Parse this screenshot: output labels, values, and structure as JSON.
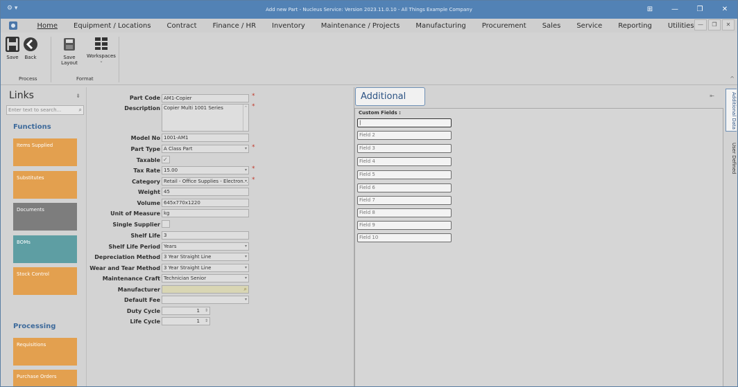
{
  "window": {
    "title": "Add new Part - Nucleus Service: Version 2023.11.0.10 - All Things Example Company",
    "controls": [
      "⊞",
      "—",
      "❐",
      "✕"
    ]
  },
  "menu": {
    "items": [
      "Home",
      "Equipment / Locations",
      "Contract",
      "Finance / HR",
      "Inventory",
      "Maintenance / Projects",
      "Manufacturing",
      "Procurement",
      "Sales",
      "Service",
      "Reporting",
      "Utilities"
    ],
    "win_controls": [
      "—",
      "❐",
      "✕"
    ]
  },
  "ribbon": {
    "save": "Save",
    "back": "Back",
    "save_layout": "Save Layout",
    "workspaces": "Workspaces",
    "group_process": "Process",
    "group_format": "Format"
  },
  "links": {
    "title": "Links",
    "search_placeholder": "Enter text to search...",
    "functions_label": "Functions",
    "processing_label": "Processing",
    "function_tiles": [
      {
        "label": "Items Supplied",
        "color": "#e3a04f"
      },
      {
        "label": "Substitutes",
        "color": "#e3a04f"
      },
      {
        "label": "Documents",
        "color": "#7d7d7d"
      },
      {
        "label": "BOMs",
        "color": "#5e9ea3"
      },
      {
        "label": "Stock Control",
        "color": "#e3a04f"
      }
    ],
    "processing_tiles": [
      {
        "label": "Requisitions",
        "color": "#e3a04f"
      },
      {
        "label": "Purchase Orders",
        "color": "#e3a04f"
      }
    ]
  },
  "form": {
    "part_code": {
      "label": "Part Code",
      "value": "AM1-Copier"
    },
    "description": {
      "label": "Description",
      "value": "Copier Multi 1001 Series"
    },
    "model_no": {
      "label": "Model No",
      "value": "1001-AM1"
    },
    "part_type": {
      "label": "Part Type",
      "value": "A Class Part"
    },
    "taxable": {
      "label": "Taxable",
      "checked": true
    },
    "tax_rate": {
      "label": "Tax Rate",
      "value": "15.00"
    },
    "category": {
      "label": "Category",
      "value": "Retail - Office Supplies - Electron..."
    },
    "weight": {
      "label": "Weight",
      "value": "45"
    },
    "volume": {
      "label": "Volume",
      "value": "645x770x1220"
    },
    "unit_of_measure": {
      "label": "Unit of Measure",
      "value": "kg"
    },
    "single_supplier": {
      "label": "Single Supplier",
      "checked": false
    },
    "shelf_life": {
      "label": "Shelf Life",
      "value": "3"
    },
    "shelf_life_period": {
      "label": "Shelf Life Period",
      "value": "Years"
    },
    "depreciation_method": {
      "label": "Depreciation Method",
      "value": "3 Year Straight Line"
    },
    "wear_tear_method": {
      "label": "Wear and Tear Method",
      "value": "3 Year Straight Line"
    },
    "maintenance_craft": {
      "label": "Maintenance Craft",
      "value": "Technician Senior"
    },
    "manufacturer": {
      "label": "Manufacturer",
      "value": ""
    },
    "default_fee": {
      "label": "Default Fee",
      "value": ""
    },
    "duty_cycle": {
      "label": "Duty Cycle",
      "value": "1"
    },
    "life_cycle": {
      "label": "Life Cycle",
      "value": "1"
    }
  },
  "additional": {
    "title": "Additional Data",
    "custom_fields_label": "Custom Fields :",
    "fields": [
      "",
      "Field 2",
      "Field 3",
      "Field 4",
      "Field 5",
      "Field 6",
      "Field 7",
      "Field 8",
      "Field 9",
      "Field 10"
    ]
  },
  "side_tabs": {
    "additional_data": "Additional Data",
    "user_defined": "User Defined"
  }
}
